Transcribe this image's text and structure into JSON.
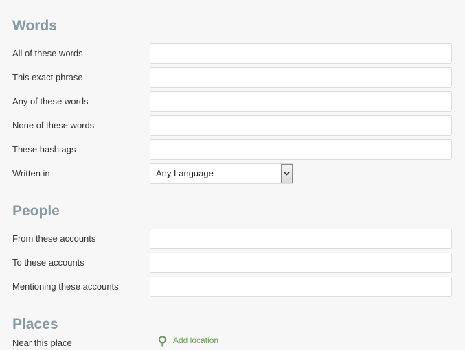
{
  "words": {
    "heading": "Words",
    "all_label": "All of these words",
    "exact_label": "This exact phrase",
    "any_label": "Any of these words",
    "none_label": "None of these words",
    "hashtags_label": "These hashtags",
    "language_label": "Written in",
    "language_selected": "Any Language"
  },
  "people": {
    "heading": "People",
    "from_label": "From these accounts",
    "to_label": "To these accounts",
    "mentioning_label": "Mentioning these accounts"
  },
  "places": {
    "heading": "Places",
    "near_label": "Near this place",
    "add_location_label": "Add location",
    "add_location_icon": "location-pin-icon"
  },
  "colors": {
    "heading": "#8899a6",
    "link": "#6b9a5a",
    "input_border": "#d9dde1",
    "background": "#f7f7f7"
  }
}
